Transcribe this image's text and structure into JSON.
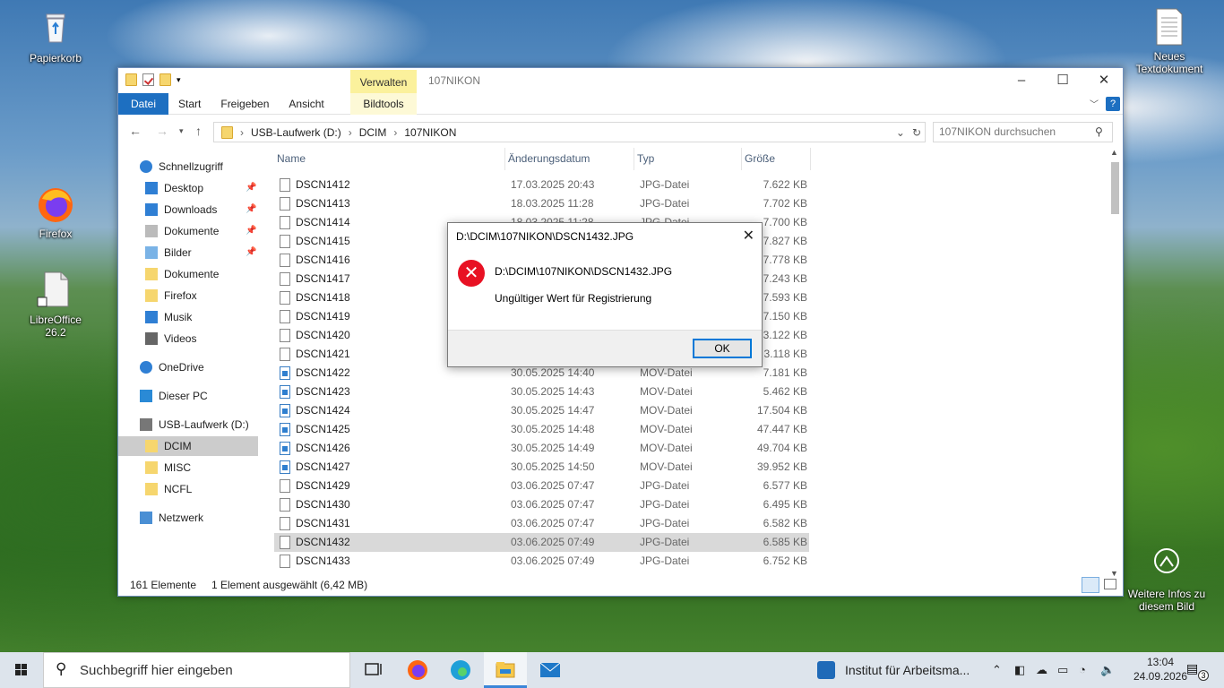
{
  "desktop": {
    "icons": [
      {
        "label": "Papierkorb",
        "icon": "recycle-bin-icon"
      },
      {
        "label": "Firefox",
        "icon": "firefox-icon"
      },
      {
        "label": "LibreOffice 26.2",
        "icon": "libreoffice-icon"
      },
      {
        "label": "Neues Textdokument",
        "icon": "text-document-icon"
      },
      {
        "label": "Weitere Infos zu diesem Bild",
        "icon": "camera-info-icon"
      }
    ]
  },
  "explorer": {
    "title": "107NIKON",
    "context_tab": "Verwalten",
    "window_controls": [
      "–",
      "☐",
      "✕"
    ],
    "ribbon_tabs": [
      "Datei",
      "Start",
      "Freigeben",
      "Ansicht"
    ],
    "context_ribbon_tab": "Bildtools",
    "address": {
      "parts": [
        "USB-Laufwerk (D:)",
        "DCIM",
        "107NIKON"
      ]
    },
    "search_placeholder": "107NIKON durchsuchen",
    "nav": [
      {
        "label": "Schnellzugriff",
        "icon": "star-icon",
        "pinned": false
      },
      {
        "label": "Desktop",
        "icon": "desktop-icon",
        "pinned": true
      },
      {
        "label": "Downloads",
        "icon": "download-icon",
        "pinned": true
      },
      {
        "label": "Dokumente",
        "icon": "documents-icon",
        "pinned": true
      },
      {
        "label": "Bilder",
        "icon": "pictures-icon",
        "pinned": true
      },
      {
        "label": "Dokumente",
        "icon": "folder-icon",
        "pinned": false
      },
      {
        "label": "Firefox",
        "icon": "folder-icon",
        "pinned": false
      },
      {
        "label": "Musik",
        "icon": "music-icon",
        "pinned": false
      },
      {
        "label": "Videos",
        "icon": "videos-icon",
        "pinned": false
      },
      {
        "label": "OneDrive",
        "icon": "cloud-icon",
        "pinned": false
      },
      {
        "label": "Dieser PC",
        "icon": "pc-icon",
        "pinned": false
      },
      {
        "label": "USB-Laufwerk (D:)",
        "icon": "usb-drive-icon",
        "pinned": false
      },
      {
        "label": "DCIM",
        "icon": "folder-icon",
        "pinned": false
      },
      {
        "label": "MISC",
        "icon": "folder-icon",
        "pinned": false
      },
      {
        "label": "NCFL",
        "icon": "folder-icon",
        "pinned": false
      },
      {
        "label": "Netzwerk",
        "icon": "network-icon",
        "pinned": false
      }
    ],
    "columns": [
      "Name",
      "Änderungsdatum",
      "Typ",
      "Größe"
    ],
    "files": [
      {
        "name": "DSCN1412",
        "date": "17.03.2025 20:43",
        "type": "JPG-Datei",
        "size": "7.622 KB"
      },
      {
        "name": "DSCN1413",
        "date": "18.03.2025 11:28",
        "type": "JPG-Datei",
        "size": "7.702 KB"
      },
      {
        "name": "DSCN1414",
        "date": "18.03.2025 11:28",
        "type": "JPG-Datei",
        "size": "7.700 KB"
      },
      {
        "name": "DSCN1415",
        "date": "",
        "type": "",
        "size": "7.827 KB"
      },
      {
        "name": "DSCN1416",
        "date": "",
        "type": "",
        "size": "7.778 KB"
      },
      {
        "name": "DSCN1417",
        "date": "",
        "type": "",
        "size": "7.243 KB"
      },
      {
        "name": "DSCN1418",
        "date": "",
        "type": "",
        "size": "7.593 KB"
      },
      {
        "name": "DSCN1419",
        "date": "",
        "type": "",
        "size": "7.150 KB"
      },
      {
        "name": "DSCN1420",
        "date": "",
        "type": "",
        "size": "3.122 KB"
      },
      {
        "name": "DSCN1421",
        "date": "",
        "type": "",
        "size": "3.118 KB"
      },
      {
        "name": "DSCN1422",
        "date": "30.05.2025 14:40",
        "type": "MOV-Datei",
        "size": "7.181 KB"
      },
      {
        "name": "DSCN1423",
        "date": "30.05.2025 14:43",
        "type": "MOV-Datei",
        "size": "5.462 KB"
      },
      {
        "name": "DSCN1424",
        "date": "30.05.2025 14:47",
        "type": "MOV-Datei",
        "size": "17.504 KB"
      },
      {
        "name": "DSCN1425",
        "date": "30.05.2025 14:48",
        "type": "MOV-Datei",
        "size": "47.447 KB"
      },
      {
        "name": "DSCN1426",
        "date": "30.05.2025 14:49",
        "type": "MOV-Datei",
        "size": "49.704 KB"
      },
      {
        "name": "DSCN1427",
        "date": "30.05.2025 14:50",
        "type": "MOV-Datei",
        "size": "39.952 KB"
      },
      {
        "name": "DSCN1429",
        "date": "03.06.2025 07:47",
        "type": "JPG-Datei",
        "size": "6.577 KB"
      },
      {
        "name": "DSCN1430",
        "date": "03.06.2025 07:47",
        "type": "JPG-Datei",
        "size": "6.495 KB"
      },
      {
        "name": "DSCN1431",
        "date": "03.06.2025 07:47",
        "type": "JPG-Datei",
        "size": "6.582 KB"
      },
      {
        "name": "DSCN1432",
        "date": "03.06.2025 07:49",
        "type": "JPG-Datei",
        "size": "6.585 KB",
        "selected": true
      },
      {
        "name": "DSCN1433",
        "date": "03.06.2025 07:49",
        "type": "JPG-Datei",
        "size": "6.752 KB"
      }
    ],
    "status": {
      "count": "161 Elemente",
      "selection": "1 Element ausgewählt (6,42 MB)"
    }
  },
  "dialog": {
    "title": "D:\\DCIM\\107NIKON\\DSCN1432.JPG",
    "path": "D:\\DCIM\\107NIKON\\DSCN1432.JPG",
    "message": "Ungültiger Wert für Registrierung",
    "ok": "OK"
  },
  "taskbar": {
    "search_placeholder": "Suchbegriff hier eingeben",
    "notification_app": "Institut für Arbeitsma...",
    "time": "13:04",
    "date": "24.09.2026",
    "notification_count": "3"
  }
}
